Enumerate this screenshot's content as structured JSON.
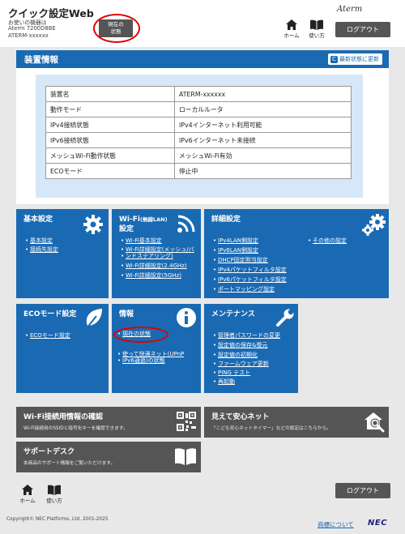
{
  "header": {
    "app_title": "クイック設定Web",
    "device_line1": "お使いの機器は",
    "device_line2": "Aterm 7200D8BE",
    "device_line3": "ATERM-xxxxxx",
    "status_button_line1": "現在の",
    "status_button_line2": "状態",
    "brand_logo": "Aterm",
    "home_label": "ホーム",
    "help_label": "使い方",
    "logout_label": "ログアウト"
  },
  "device_info": {
    "title": "装置情報",
    "refresh_label": "最新状態に更新",
    "rows": [
      {
        "key": "装置名",
        "value": "ATERM-xxxxxx"
      },
      {
        "key": "動作モード",
        "value": "ローカルルータ"
      },
      {
        "key": "IPv4接続状態",
        "value": "IPv4インターネット利用可能"
      },
      {
        "key": "IPv6接続状態",
        "value": "IPv6インターネット未接続"
      },
      {
        "key": "メッシュWi-Fi動作状態",
        "value": "メッシュWi-Fi有効"
      },
      {
        "key": "ECOモード",
        "value": "停止中"
      }
    ]
  },
  "tiles": {
    "basic": {
      "title": "基本設定",
      "links": [
        "基本設定",
        "接続先設定"
      ]
    },
    "wifi": {
      "title_main": "Wi-Fi",
      "title_paren": "(無線LAN)",
      "title_line2": "設定",
      "links": [
        "Wi-Fi基本設定",
        "Wi-Fi詳細設定(メッシュ/バ",
        "ンドステアリング)",
        "Wi-Fi詳細設定(2.4GHz)",
        "Wi-Fi詳細設定(5GHz)"
      ]
    },
    "advanced": {
      "title": "詳細設定",
      "links": [
        "IPv4LAN側設定",
        "IPv6LAN側設定",
        "DHCP固定割当設定",
        "IPv4パケットフィルタ設定",
        "IPv6パケットフィルタ設定",
        "ポートマッピング設定"
      ],
      "other": "その他の設定"
    },
    "eco": {
      "title": "ECOモード設定",
      "links": [
        "ECOモード設定"
      ]
    },
    "info": {
      "title": "情報",
      "links": [
        "現在の状態",
        "使って快適ネット(UPnP",
        "IPv6通過)の状態"
      ]
    },
    "maint": {
      "title": "メンテナンス",
      "links": [
        "管理者パスワードの変更",
        "設定値の保存&復元",
        "設定値の初期化",
        "ファームウェア更新",
        "PING テスト",
        "再起動"
      ]
    }
  },
  "wide_tiles": {
    "wifi_info": {
      "title": "Wi-Fi接続用情報の確認",
      "subtitle": "Wi-Fi接続用のSSIDと暗号化キーを確認できます。"
    },
    "safe_net": {
      "title": "見えて安心ネット",
      "subtitle": "「こども安心ネットタイマー」などの設定はこちらから。"
    },
    "support": {
      "title": "サポートデスク",
      "subtitle": "本商品のサポート情報をご覧いただけます。"
    }
  },
  "footer": {
    "home_label": "ホーム",
    "help_label": "使い方",
    "logout_label": "ログアウト",
    "copyright": "Copyright© NEC Platforms, Ltd. 2001-2025",
    "trademark_link": "商標について",
    "nec_logo": "NEC"
  },
  "colors": {
    "accent_blue": "#1a6ab3",
    "tile_gray": "#555555",
    "highlight_red": "#e00000",
    "info_box_bg": "#d6e7f7"
  }
}
